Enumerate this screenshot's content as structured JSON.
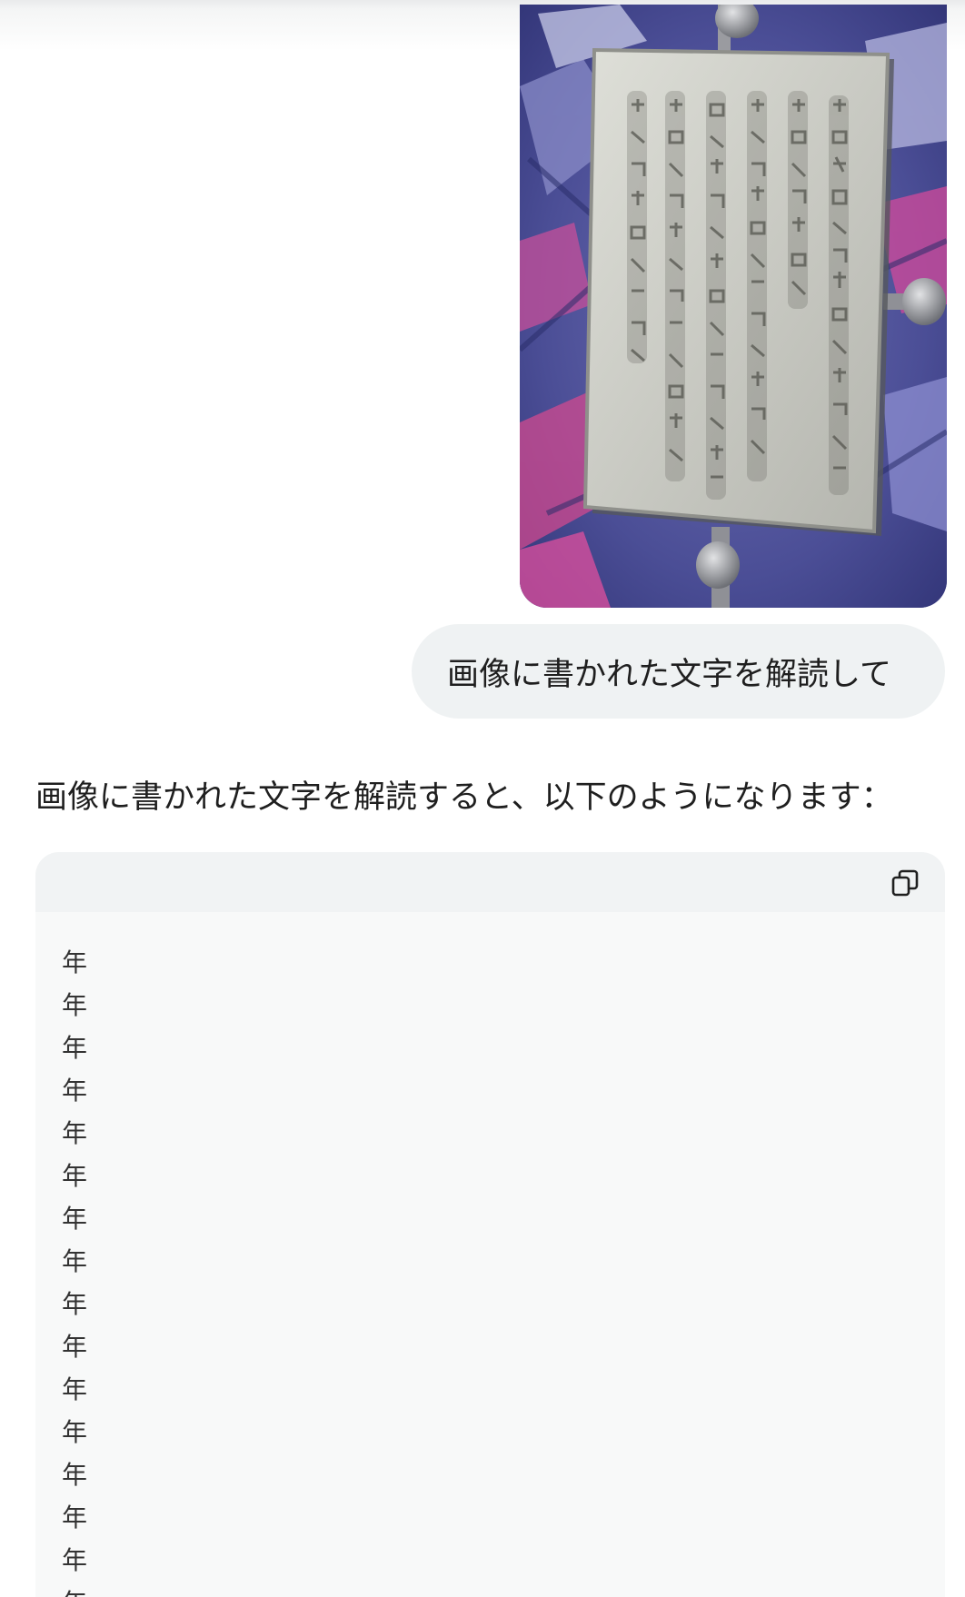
{
  "attachment": {
    "icon": "photo-of-engraved-metal-plaque"
  },
  "user_message": {
    "text": "画像に書かれた文字を解読して"
  },
  "assistant_message": {
    "intro": "画像に書かれた文字を解読すると、以下のようになります：",
    "code_block": {
      "copy_icon": "copy-icon",
      "lines": [
        "年",
        "年",
        "年",
        "年",
        "年",
        "年",
        "年",
        "年",
        "年",
        "年",
        "年",
        "年",
        "年",
        "年",
        "年",
        "年"
      ]
    }
  },
  "colors": {
    "user_bubble": "#eff2f3",
    "code_background": "#f8f9f9",
    "code_header": "#f1f3f4",
    "text": "#1f1f1f"
  }
}
